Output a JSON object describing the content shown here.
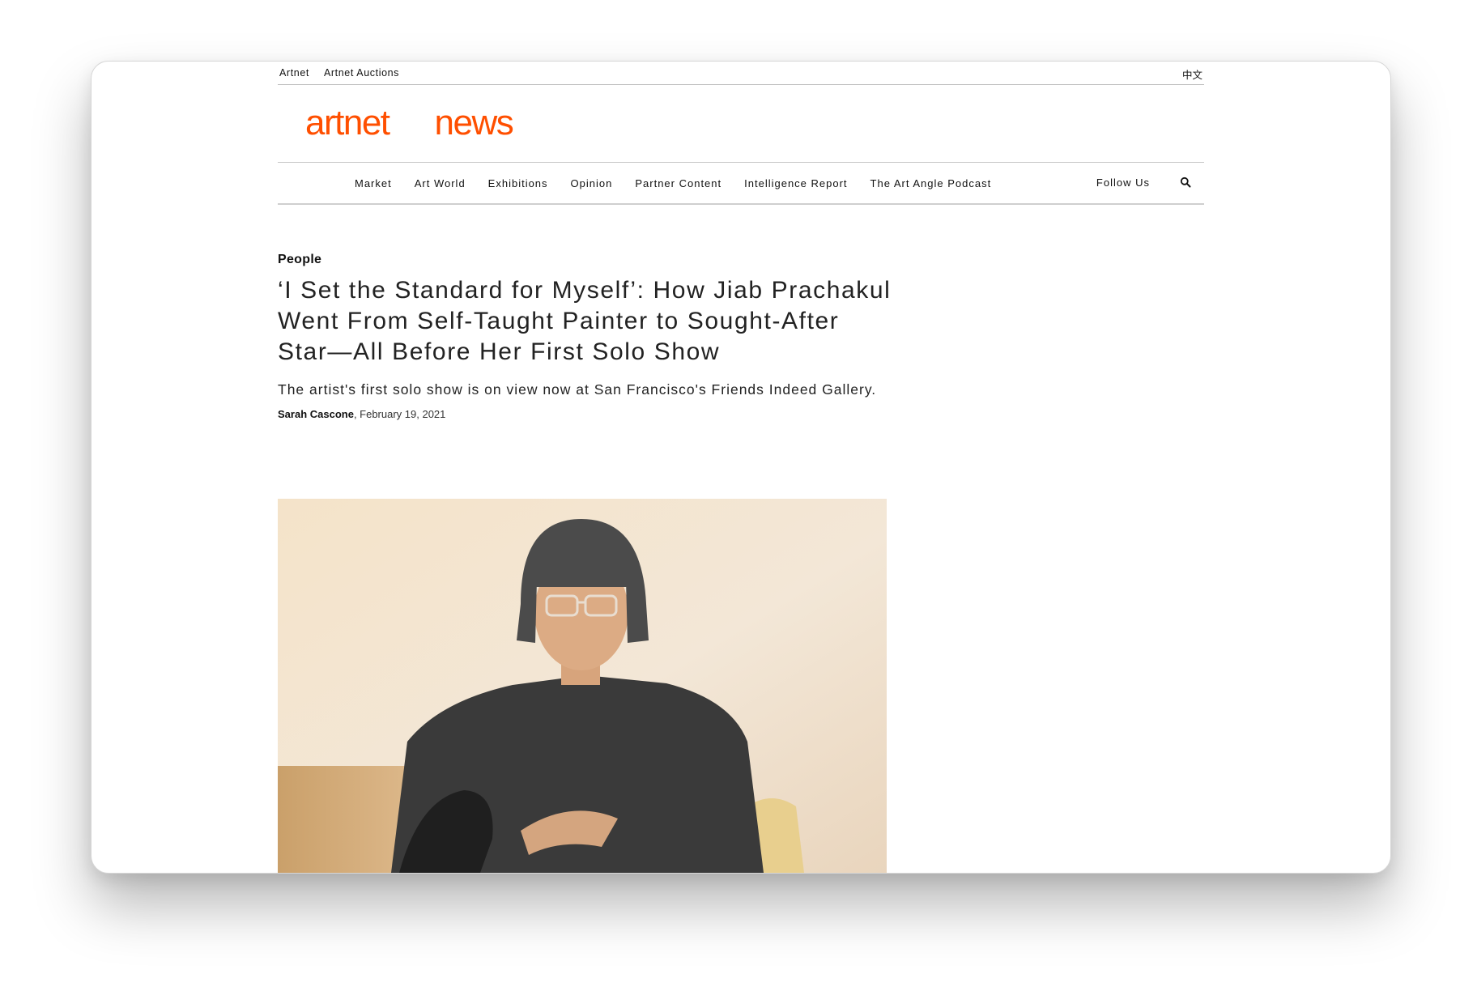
{
  "utility": {
    "links": [
      "Artnet",
      "Artnet Auctions"
    ],
    "language": "中文"
  },
  "logo": {
    "word1": "artnet",
    "word2": "news",
    "color": "#ff4f00"
  },
  "nav": {
    "items": [
      "Market",
      "Art World",
      "Exhibitions",
      "Opinion",
      "Partner Content",
      "Intelligence Report",
      "The Art Angle Podcast"
    ],
    "follow_label": "Follow Us",
    "search_icon": "search-icon"
  },
  "article": {
    "category": "People",
    "headline": "‘I Set the Standard for Myself’: How Jiab Prachakul Went From Self-Taught Painter to Sought-After Star—All Before Her First Solo Show",
    "dek": "The artist's first solo show is on view now at San Francisco's Friends Indeed Gallery.",
    "author": "Sarah Cascone",
    "date": ", February 19, 2021"
  },
  "hero_image": {
    "subject": "portrait-photo"
  }
}
